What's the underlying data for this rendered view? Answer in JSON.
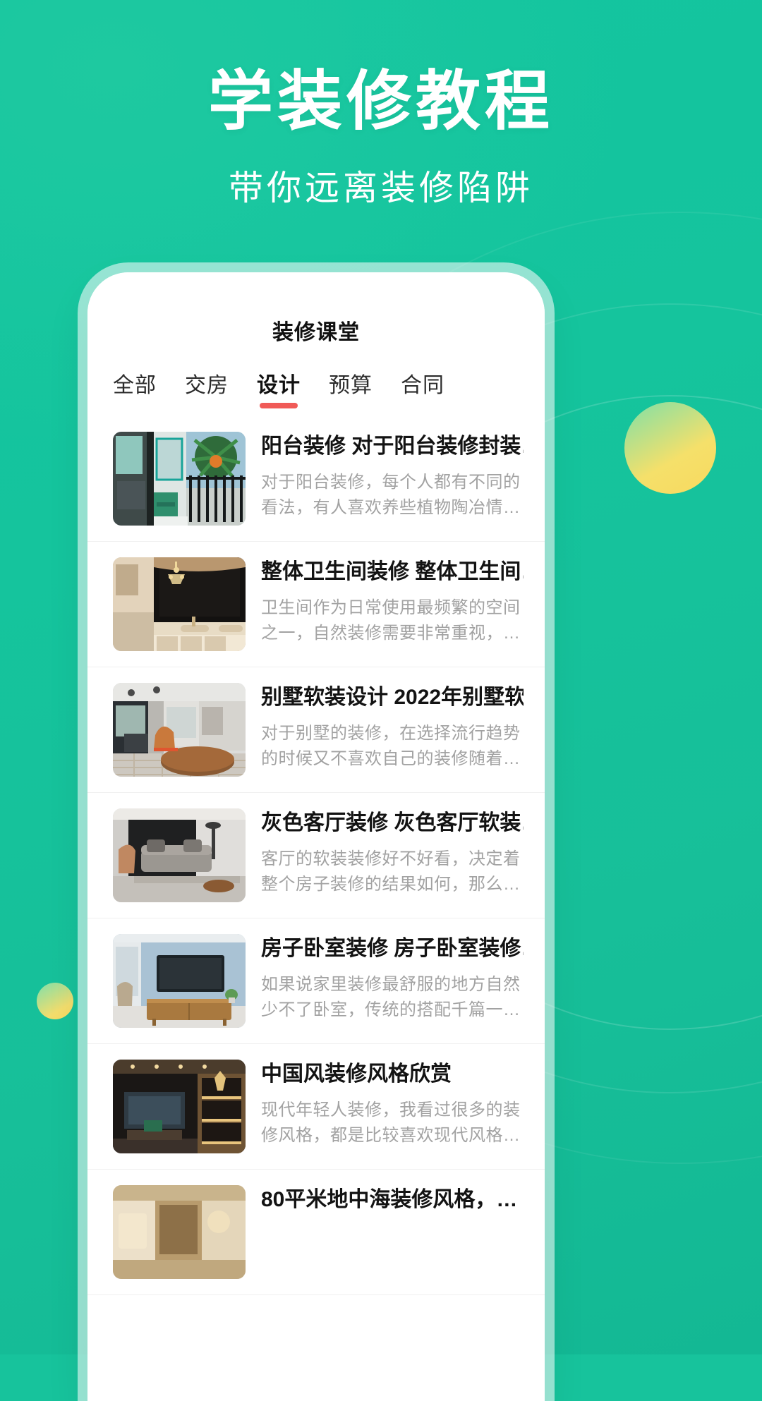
{
  "poster": {
    "headline": "学装修教程",
    "subheadline": "带你远离装修陷阱",
    "background_color": "#15c49d",
    "accent_color": "#f05a57"
  },
  "app": {
    "header_title": "装修课堂",
    "tabs": [
      {
        "label": "全部",
        "active": false
      },
      {
        "label": "交房",
        "active": false
      },
      {
        "label": "设计",
        "active": true
      },
      {
        "label": "预算",
        "active": false
      },
      {
        "label": "合同",
        "active": false
      }
    ],
    "articles": [
      {
        "title": "阳台装修 对于阳台装修封装…",
        "desc": "对于阳台装修，每个人都有不同的看法，有人喜欢养些植物陶冶情…",
        "thumb": "balcony-with-plants-photo"
      },
      {
        "title": "整体卫生间装修 整体卫生间…",
        "desc": "卫生间作为日常使用最频繁的空间之一，自然装修需要非常重视，…",
        "thumb": "luxury-bathroom-photo"
      },
      {
        "title": "别墅软装设计 2022年别墅软…",
        "desc": "对于别墅的装修，在选择流行趋势的时候又不喜欢自己的装修随着…",
        "thumb": "villa-living-room-photo"
      },
      {
        "title": "灰色客厅装修 灰色客厅软装…",
        "desc": "客厅的软装装修好不好看，决定着整个房子装修的结果如何，那么…",
        "thumb": "grey-living-room-photo"
      },
      {
        "title": "房子卧室装修 房子卧室装修…",
        "desc": "如果说家里装修最舒服的地方自然少不了卧室，传统的搭配千篇一…",
        "thumb": "bedroom-with-tv-photo"
      },
      {
        "title": "中国风装修风格欣赏",
        "desc": "现代年轻人装修，我看过很多的装修风格，都是比较喜欢现代风格…",
        "thumb": "chinese-style-room-photo"
      },
      {
        "title": "80平米地中海装修风格，…",
        "desc": "",
        "thumb": "mediterranean-style-photo"
      }
    ]
  }
}
